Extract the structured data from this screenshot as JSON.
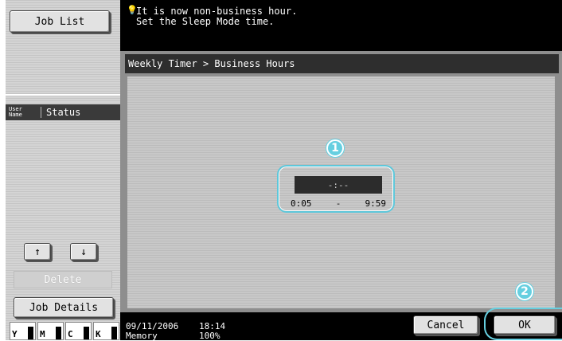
{
  "sidebar": {
    "job_list_label": "Job List",
    "col_user_name": "User\nName",
    "col_status": "Status",
    "up_arrow": "↑",
    "down_arrow": "↓",
    "delete_label": "Delete",
    "job_details_label": "Job Details",
    "toner": [
      {
        "label": "Y",
        "level": 0.8
      },
      {
        "label": "M",
        "level": 0.8
      },
      {
        "label": "C",
        "level": 0.8
      },
      {
        "label": "K",
        "level": 0.8
      }
    ]
  },
  "message": {
    "icon": "bulb-icon",
    "line1": "It is now non-business hour.",
    "line2": "Set the Sleep Mode time."
  },
  "breadcrumb": "Weekly Timer > Business Hours",
  "time": {
    "display_value": "-:--",
    "range_start": "0:05",
    "range_separator": "-",
    "range_end": "9:59"
  },
  "callouts": [
    "1",
    "2"
  ],
  "status": {
    "date": "09/11/2006",
    "time": "18:14",
    "memory_label": "Memory",
    "memory_value": "100%"
  },
  "buttons": {
    "cancel_label": "Cancel",
    "ok_label": "OK"
  },
  "colors": {
    "callout": "#66cfe0",
    "highlight_ring": "#5ec7da"
  }
}
